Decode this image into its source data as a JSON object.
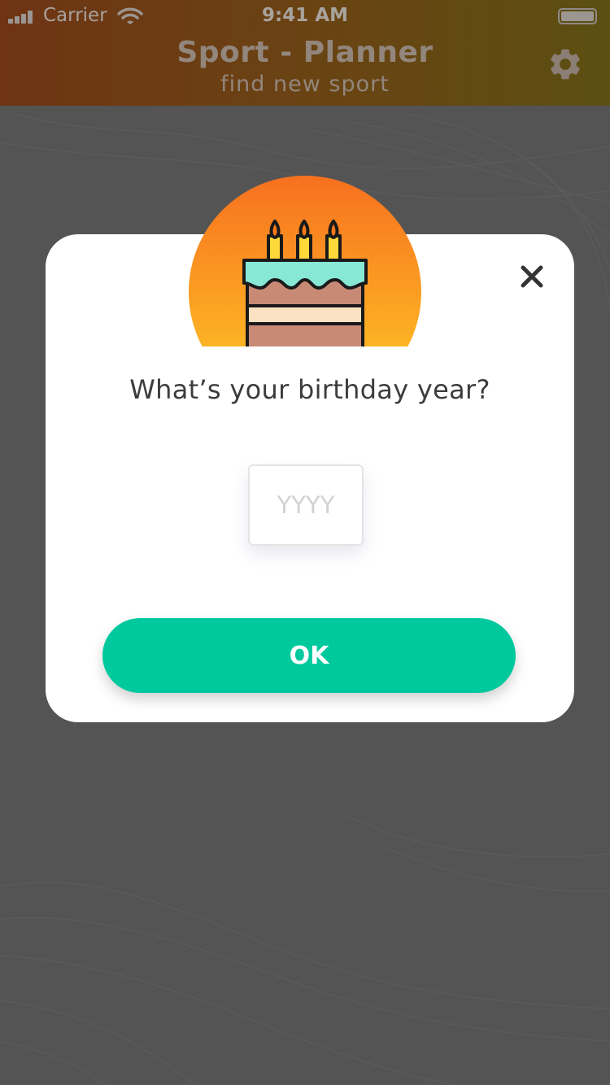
{
  "status_bar": {
    "carrier": "Carrier",
    "time": "9:41 AM"
  },
  "header": {
    "title": "Sport - Planner",
    "subtitle": "find new sport",
    "settings_icon": "gear-icon"
  },
  "modal": {
    "illustration_icon": "birthday-cake-icon",
    "close_icon": "close-icon",
    "question": "What’s your birthday year?",
    "year_input": {
      "value": "",
      "placeholder": "YYYY"
    },
    "ok_label": "OK"
  },
  "colors": {
    "overlay": "#545454",
    "accent_button": "#00c99e",
    "badge_gradient_top": "#f7701f",
    "badge_gradient_bottom": "#ffcb26"
  }
}
